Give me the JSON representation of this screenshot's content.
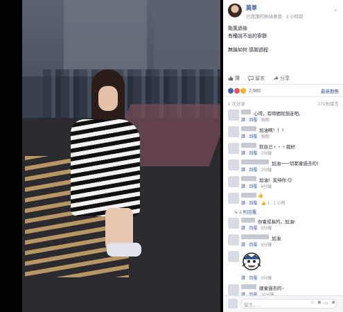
{
  "post": {
    "author": "莫莘",
    "meta": "已按讚的粉絲專頁 · 3 小時前",
    "lines": [
      "颱風過後",
      "有種說不出的寧靜",
      "",
      "無論如何 感謝過程"
    ]
  },
  "actions": {
    "like": "讚",
    "comment": "留言",
    "share": "分享"
  },
  "reactions": {
    "count": "2,980",
    "sort": "最新動態",
    "colors": [
      "#4267b2",
      "#f25268",
      "#f7b125"
    ]
  },
  "shares": {
    "left": "1 次分享",
    "right": "271則留言"
  },
  "comments": [
    {
      "text": "心得，有時間就想走吧。",
      "meta": [
        "讚",
        "回覆",
        "剛剛"
      ]
    },
    {
      "text": "加油啊！！！",
      "meta": [
        "讚",
        "回覆",
        "剛剛"
      ]
    },
    {
      "text": "就自己・・・我好",
      "meta": [
        "讚",
        "回覆",
        "2分鐘"
      ]
    },
    {
      "text": "加油一一切都會過去的！",
      "meta": [
        "讚",
        "回覆",
        "2分鐘"
      ]
    },
    {
      "text": "加油！支持你 😊",
      "meta": [
        "讚",
        "回覆",
        "6分鐘"
      ]
    },
    {
      "text": "👍",
      "meta": [
        "讚",
        "回覆",
        "",
        "1",
        "1 小時"
      ]
    },
    {
      "text": "你會成長的，加油!",
      "meta": [
        "讚",
        "回覆",
        "6分鐘"
      ]
    },
    {
      "text": "加油",
      "meta": [
        "讚",
        "回覆",
        "6分鐘"
      ]
    },
    {
      "text": "",
      "meta": [
        "讚",
        "回覆",
        "9分鐘"
      ]
    },
    {
      "text": "總會過去的~",
      "meta": [
        "讚",
        "回覆",
        "10分鐘"
      ]
    }
  ],
  "reply_link": "1 則回覆",
  "composer": {
    "placeholder": "留言......"
  },
  "icons": {
    "like": "thumbs-up-icon",
    "comment": "speech-bubble-icon",
    "share": "share-arrow-icon"
  }
}
